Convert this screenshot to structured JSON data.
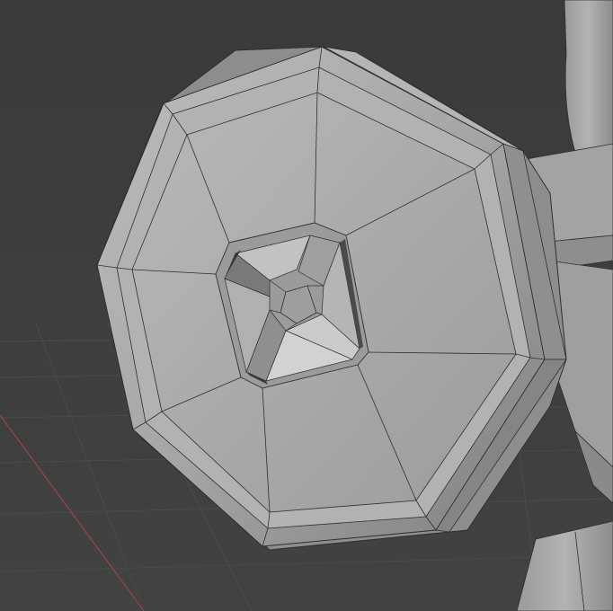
{
  "viewport": {
    "background_color": "#3d3d3d",
    "grid_color": "#4a4a4a",
    "x_axis_color": "#a04a4a"
  },
  "model": {
    "face_color": "#a9a9a9",
    "bevel_light": "#c4c4c4",
    "bevel_dark": "#8a8a8a",
    "wire_color": "#2e2e2e",
    "shadow_color": "#5a5a5a"
  }
}
